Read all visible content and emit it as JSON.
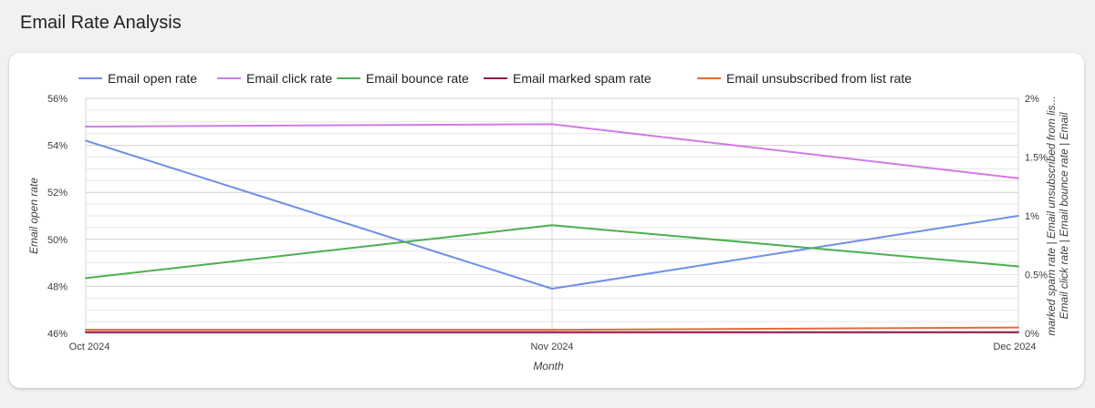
{
  "page": {
    "title": "Email Rate Analysis"
  },
  "chart_data": {
    "type": "line",
    "xlabel": "Month",
    "ylabel_left": "Email open rate",
    "ylabel_right_line1": "marked spam rate | Email unsubscribed from lis...",
    "ylabel_right_line2": "Email click rate | Email bounce rate | Email",
    "categories": [
      "Oct 2024",
      "Nov 2024",
      "Dec 2024"
    ],
    "left_axis": {
      "ylim": [
        46,
        56
      ],
      "ticks": [
        "46%",
        "48%",
        "50%",
        "52%",
        "54%",
        "56%"
      ]
    },
    "right_axis": {
      "ylim": [
        0,
        2
      ],
      "ticks": [
        "0%",
        "0.5%",
        "1%",
        "1.5%",
        "2%"
      ]
    },
    "grid": true,
    "legend_position": "top",
    "series": [
      {
        "name": "Email open rate",
        "axis": "left",
        "color": "#6f8fe6",
        "values": [
          54.2,
          47.9,
          51.0
        ]
      },
      {
        "name": "Email click rate",
        "axis": "right",
        "color": "#cf7be6",
        "values": [
          1.76,
          1.78,
          1.32
        ]
      },
      {
        "name": "Email bounce rate",
        "axis": "right",
        "color": "#4caf50",
        "values": [
          0.47,
          0.92,
          0.57
        ]
      },
      {
        "name": "Email marked spam rate",
        "axis": "right",
        "color": "#8e1b4a",
        "values": [
          0.01,
          0.01,
          0.01
        ]
      },
      {
        "name": "Email unsubscribed from list rate",
        "axis": "right",
        "color": "#e8693c",
        "values": [
          0.03,
          0.03,
          0.05
        ]
      }
    ]
  }
}
